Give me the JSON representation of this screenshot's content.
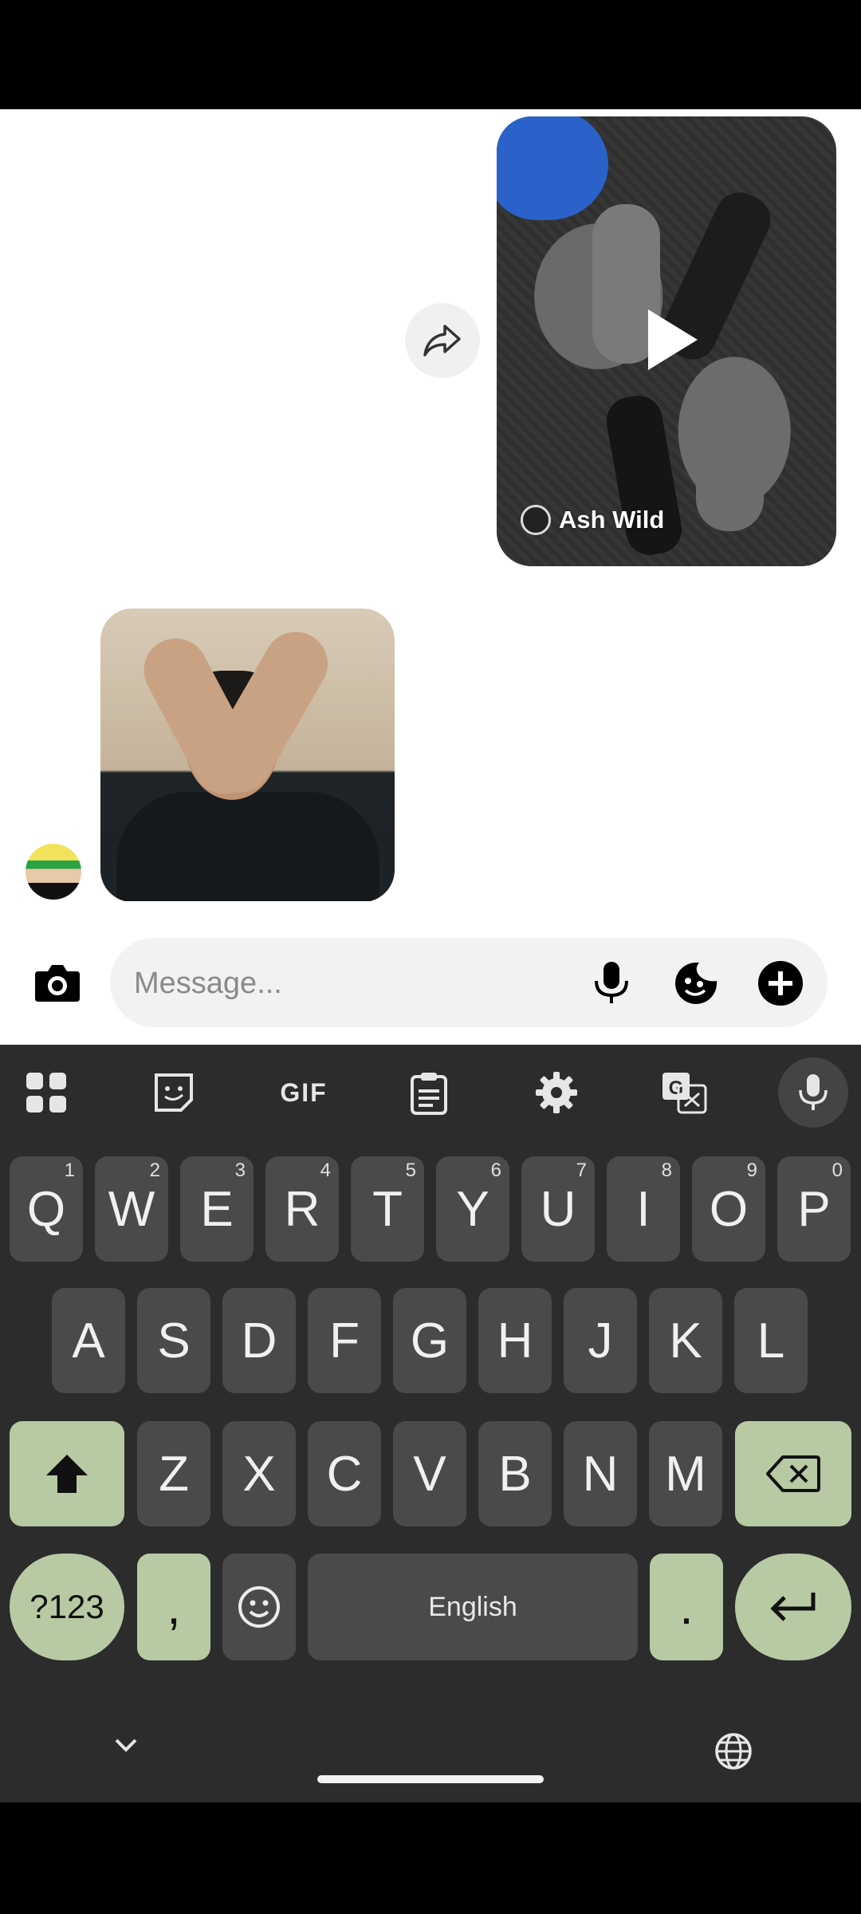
{
  "chat": {
    "shared_video": {
      "author": "Ash Wild"
    },
    "composer": {
      "placeholder": "Message..."
    }
  },
  "keyboard": {
    "toolbar": {
      "gif_label": "GIF"
    },
    "row1": [
      {
        "key": "Q",
        "hint": "1"
      },
      {
        "key": "W",
        "hint": "2"
      },
      {
        "key": "E",
        "hint": "3"
      },
      {
        "key": "R",
        "hint": "4"
      },
      {
        "key": "T",
        "hint": "5"
      },
      {
        "key": "Y",
        "hint": "6"
      },
      {
        "key": "U",
        "hint": "7"
      },
      {
        "key": "I",
        "hint": "8"
      },
      {
        "key": "O",
        "hint": "9"
      },
      {
        "key": "P",
        "hint": "0"
      }
    ],
    "row2": [
      "A",
      "S",
      "D",
      "F",
      "G",
      "H",
      "J",
      "K",
      "L"
    ],
    "row3": [
      "Z",
      "X",
      "C",
      "V",
      "B",
      "N",
      "M"
    ],
    "row4": {
      "symbols": "?123",
      "comma": ",",
      "space": "English",
      "period": "."
    }
  },
  "colors": {
    "accent_key": "#b7caa4",
    "key": "#4a4a4a",
    "keyboard_bg": "#2c2c2c"
  }
}
